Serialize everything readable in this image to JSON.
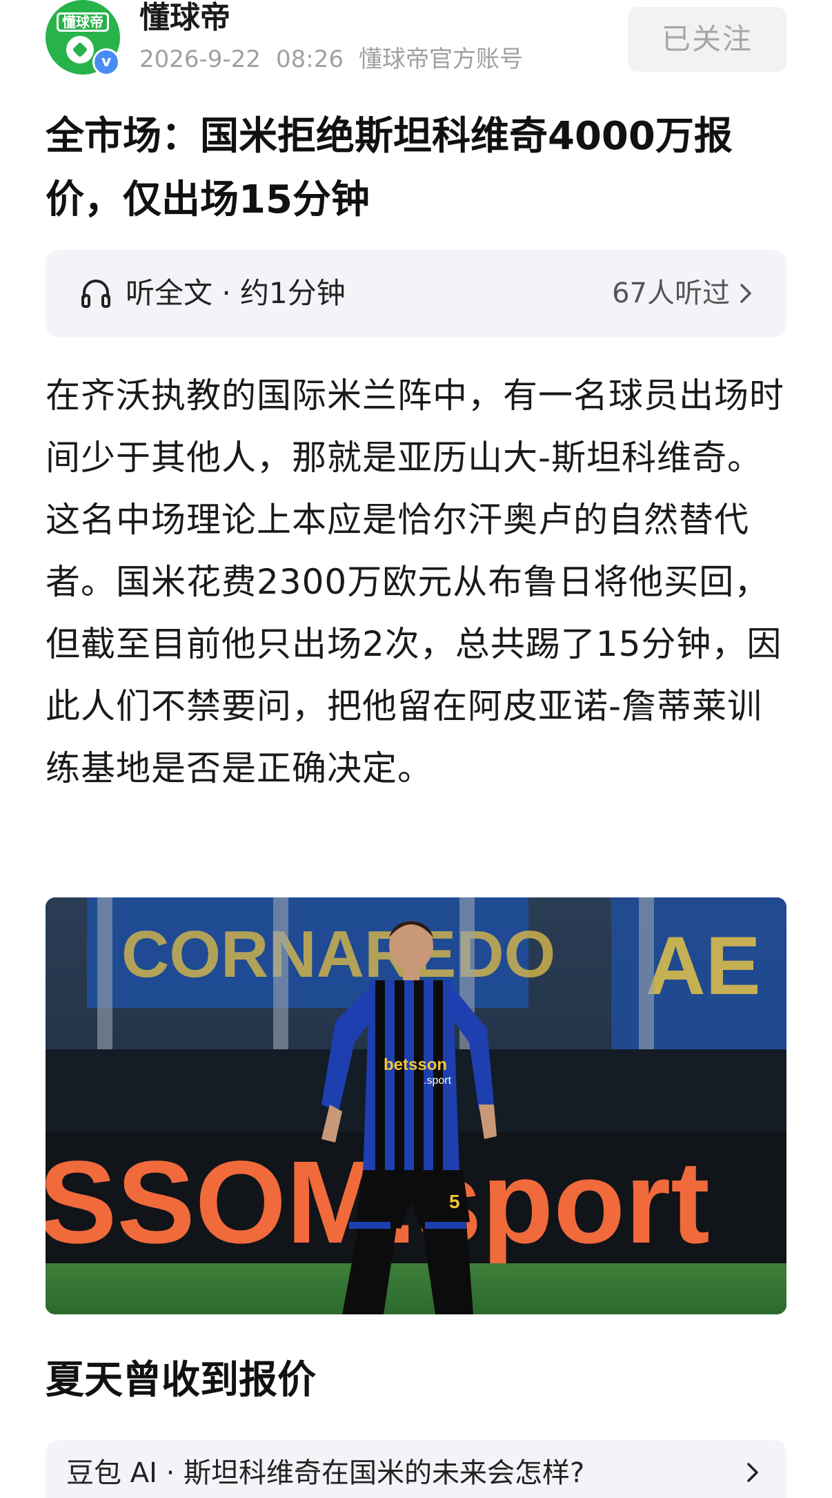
{
  "header": {
    "author_name": "懂球帝",
    "avatar_text": "懂球帝",
    "verified_badge": "v",
    "date": "2026-9-22",
    "time": "08:26",
    "account_type": "懂球帝官方账号",
    "follow_label": "已关注"
  },
  "article": {
    "title": "全市场：国米拒绝斯坦科维奇4000万报价，仅出场15分钟",
    "listen": {
      "label": "听全文 · 约1分钟",
      "count": "67人听过"
    },
    "body": "在齐沃执教的国际米兰阵中，有一名球员出场时间少于其他人，那就是亚历山大-斯坦科维奇。这名中场理论上本应是恰尔汗奥卢的自然替代者。国米花费2300万欧元从布鲁日将他买回，但截至目前他只出场2次，总共踢了15分钟，因此人们不禁要问，把他留在阿皮亚诺-詹蒂莱训练基地是否是正确决定。",
    "photo": {
      "banner_text": "CORNAREDO",
      "banner_text_right": "AE",
      "ad_board_text": "SSOM.sport",
      "sponsor_text": "betsson",
      "sponsor_subtext": ".sport",
      "shirt_number": "5"
    },
    "section_heading": "夏天曾收到报价"
  },
  "ai_prompt": {
    "text": "豆包 AI · 斯坦科维奇在国米的未来会怎样?"
  },
  "colors": {
    "brand_green": "#27b34a",
    "verify_blue": "#4a8cf5",
    "muted_text": "#a0a0a0",
    "panel_bg": "#f3f4f8"
  }
}
